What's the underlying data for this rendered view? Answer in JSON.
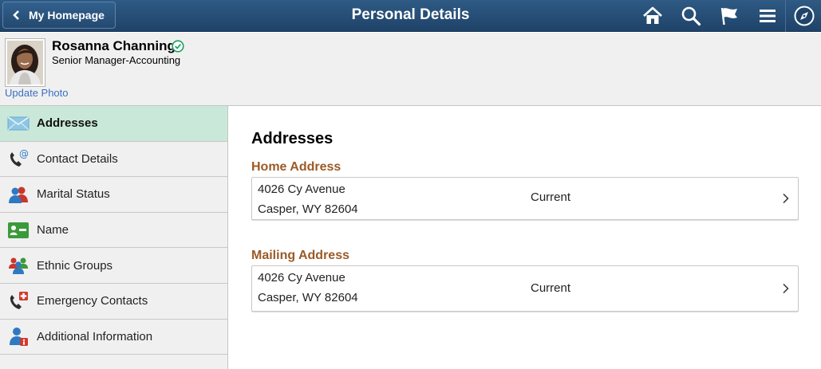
{
  "banner": {
    "back_label": "My Homepage",
    "title": "Personal Details",
    "icons": [
      "chevron-left-icon",
      "home-icon",
      "search-icon",
      "flag-icon",
      "menu-icon",
      "navbar-compass-icon"
    ],
    "background": "#2a5580"
  },
  "employee": {
    "name": "Rosanna Channing",
    "job_title": "Senior Manager-Accounting",
    "update_photo_label": "Update Photo",
    "status_icon": "check-circle-icon",
    "status_color": "#1f9f62"
  },
  "sidebar": {
    "selected_color": "#c9e8d9",
    "items": [
      {
        "label": "Addresses",
        "icon": "envelope-icon",
        "selected": true
      },
      {
        "label": "Contact Details",
        "icon": "phone-at-icon"
      },
      {
        "label": "Marital Status",
        "icon": "couple-icon"
      },
      {
        "label": "Name",
        "icon": "id-card-icon"
      },
      {
        "label": "Ethnic Groups",
        "icon": "group-icon"
      },
      {
        "label": "Emergency Contacts",
        "icon": "phone-emergency-icon"
      },
      {
        "label": "Additional Information",
        "icon": "person-info-icon"
      }
    ]
  },
  "main": {
    "heading": "Addresses",
    "accent_color": "#9b5a26",
    "groups": [
      {
        "title": "Home Address",
        "line1": "4026 Cy Avenue",
        "line2": "Casper, WY 82604",
        "status": "Current"
      },
      {
        "title": "Mailing Address",
        "line1": "4026 Cy Avenue",
        "line2": "Casper, WY 82604",
        "status": "Current"
      }
    ]
  }
}
